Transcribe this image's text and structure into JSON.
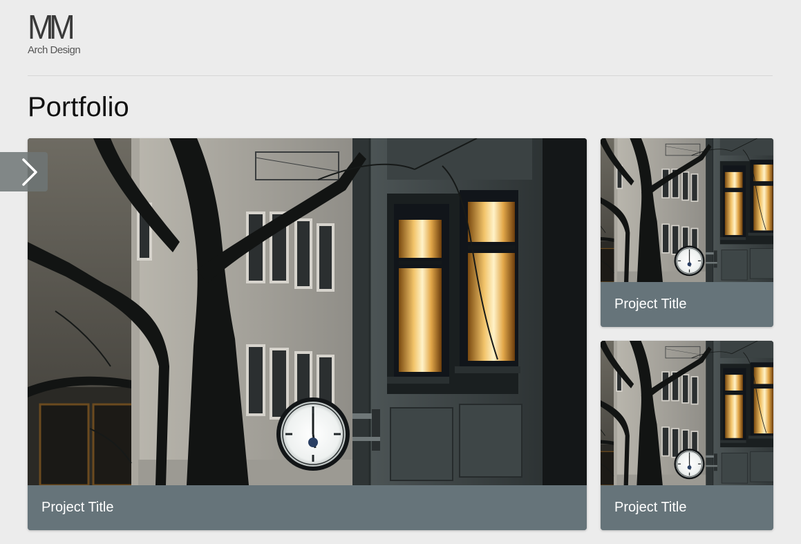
{
  "logo": {
    "mark": "MM",
    "tagline": "Arch Design"
  },
  "page": {
    "title": "Portfolio"
  },
  "projects": [
    {
      "title": "Project Title"
    },
    {
      "title": "Project Title"
    },
    {
      "title": "Project Title"
    }
  ],
  "icons": {
    "next": "chevron-right-icon"
  },
  "colors": {
    "background": "#ececec",
    "caption_bar": "#66747a",
    "caption_text": "#ffffff",
    "arrow_button": "#6e7676"
  }
}
